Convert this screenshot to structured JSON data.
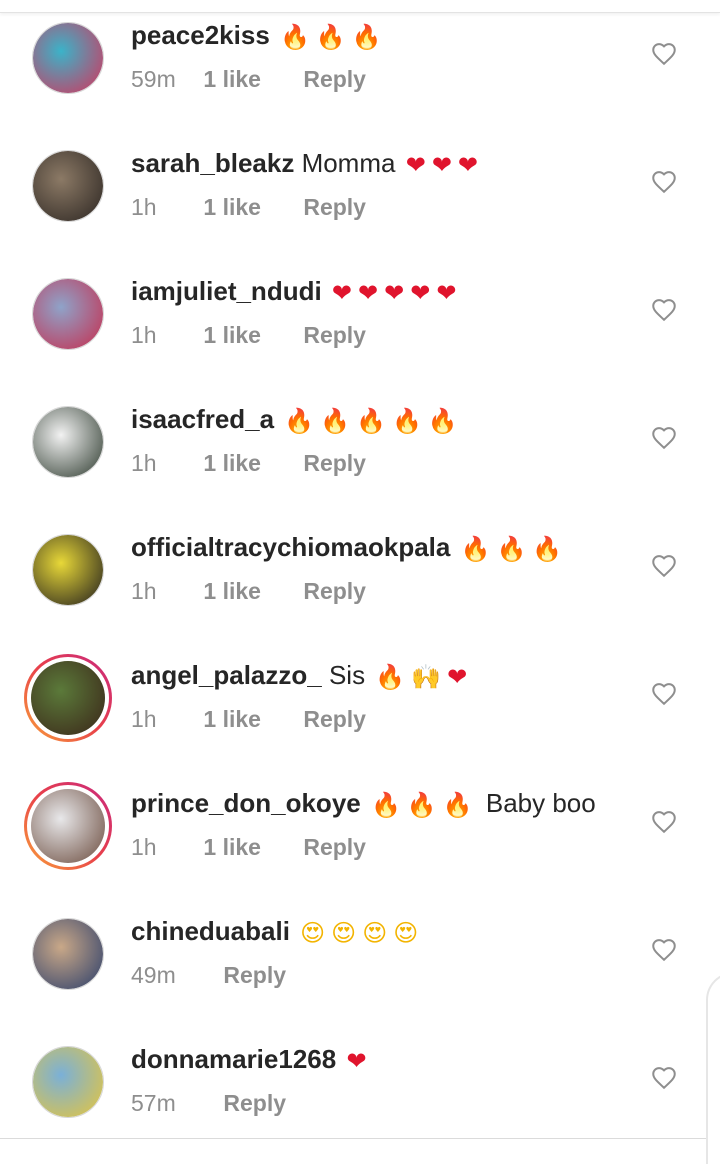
{
  "comments": [
    {
      "username": "peace2kiss",
      "text": "",
      "emoji": "🔥🔥🔥",
      "emoji_color": "#ff7a00",
      "time": "59m",
      "likes": "1 like",
      "reply": "Reply",
      "avatar_colors": [
        "#3bb3c9",
        "#d6325a"
      ],
      "avatar_ring": false
    },
    {
      "username": "sarah_bleakz",
      "text": "Momma",
      "emoji": "❤❤❤",
      "emoji_color": "#e0142d",
      "time": "1h",
      "likes": "1 like",
      "reply": "Reply",
      "avatar_colors": [
        "#8c7a66",
        "#2b2521"
      ],
      "avatar_ring": false
    },
    {
      "username": "iamjuliet_ndudi",
      "text": "",
      "emoji": "❤❤❤❤❤",
      "emoji_color": "#e0142d",
      "time": "1h",
      "likes": "1 like",
      "reply": "Reply",
      "avatar_colors": [
        "#8fa3c9",
        "#c62c4d"
      ],
      "avatar_ring": false
    },
    {
      "username": "isaacfred_a",
      "text": "",
      "emoji": "🔥🔥🔥🔥🔥",
      "emoji_color": "#ff7a00",
      "time": "1h",
      "likes": "1 like",
      "reply": "Reply",
      "avatar_colors": [
        "#f2f2f2",
        "#2d3a2e"
      ],
      "avatar_ring": false
    },
    {
      "username": "officialtracychiomaokpala",
      "text": "",
      "emoji": "🔥🔥🔥",
      "emoji_color": "#ff7a00",
      "time": "1h",
      "likes": "1 like",
      "reply": "Reply",
      "avatar_colors": [
        "#e8d838",
        "#1e1b1c"
      ],
      "avatar_ring": false
    },
    {
      "username": "angel_palazzo_",
      "text": "Sis",
      "emoji": "🔥🙌❤",
      "emoji_color": "#e0142d",
      "time": "1h",
      "likes": "1 like",
      "reply": "Reply",
      "avatar_colors": [
        "#5b7a3a",
        "#3a2418"
      ],
      "avatar_ring": true
    },
    {
      "username": "prince_don_okoye",
      "text": "",
      "emoji": "🔥🔥🔥",
      "emoji_color": "#ff7a00",
      "text_after": "Baby boo",
      "time": "1h",
      "likes": "1 like",
      "reply": "Reply",
      "avatar_colors": [
        "#e8e8ea",
        "#6a4a3c"
      ],
      "avatar_ring": true
    },
    {
      "username": "chineduabali",
      "text": "",
      "emoji": "😍😍😍😍",
      "emoji_color": "#f3b400",
      "time": "49m",
      "likes": "",
      "reply": "Reply",
      "avatar_colors": [
        "#c9a888",
        "#2a3d6a"
      ],
      "avatar_ring": false
    },
    {
      "username": "donnamarie1268",
      "text": "",
      "emoji": "❤",
      "emoji_color": "#e0142d",
      "time": "57m",
      "likes": "",
      "reply": "Reply",
      "avatar_colors": [
        "#7ab0d8",
        "#e8c63a"
      ],
      "avatar_ring": false
    }
  ],
  "colors": {
    "text": "#262626",
    "meta": "#8e8e8e",
    "heart_outline": "#8e8e8e"
  },
  "icons": {
    "like": "heart-outline-icon"
  }
}
